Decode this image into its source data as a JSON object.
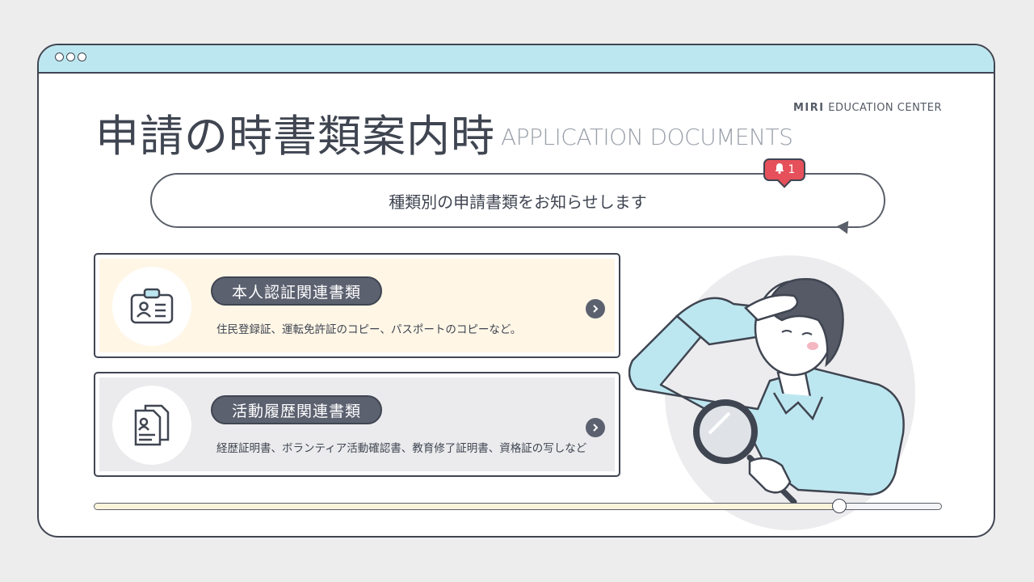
{
  "window": {
    "brand_bold": "MIRI",
    "brand_rest": " EDUCATION CENTER",
    "title": "申請の時書類案内時",
    "subtitle": "APPLICATION DOCUMENTS"
  },
  "banner": {
    "text": "種類別の申請書類をお知らせします",
    "notification_count": "1"
  },
  "cards": [
    {
      "label": "本人認証関連書類",
      "description": "住民登録証、運転免許証のコピー、パスポートのコピーなど。",
      "icon": "id-card-icon"
    },
    {
      "label": "活動履歴関連書類",
      "description": "経歴証明書、ボランティア活動確認書、教育修了証明書、資格証の写しなど",
      "icon": "documents-icon"
    }
  ],
  "progress": {
    "value": 0.88
  },
  "colors": {
    "titlebar": "#bde7f0",
    "card1_bg": "#fff6e6",
    "card2_bg": "#ebebed",
    "badge": "#e5505a",
    "pill": "#5c6170",
    "shirt": "#bde7f0"
  }
}
